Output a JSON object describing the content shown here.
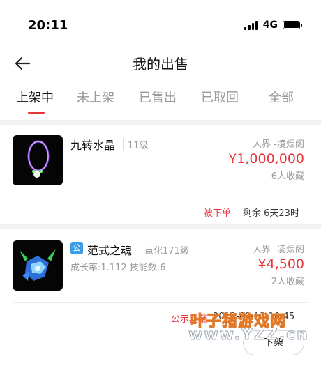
{
  "status_bar": {
    "time": "20:11",
    "network": "4G"
  },
  "header": {
    "title": "我的出售",
    "back_icon": "arrow-left-icon"
  },
  "tabs": [
    {
      "label": "上架中",
      "active": true
    },
    {
      "label": "未上架",
      "active": false
    },
    {
      "label": "已售出",
      "active": false
    },
    {
      "label": "已取回",
      "active": false
    },
    {
      "label": "全部",
      "active": false
    }
  ],
  "accent_color": "#e8333c",
  "listings": [
    {
      "name": "九转水晶",
      "level": "11级",
      "server": "人界 -凌烟阁",
      "price": "¥1,000,000",
      "favorites": "6人收藏",
      "status_label": "被下单",
      "remaining": "剩余 6天23时",
      "thumbnail_icon": "crystal-necklace-icon"
    },
    {
      "badge": "公",
      "name": "范式之魂",
      "level": "点化171级",
      "server": "人界 -凌烟阁",
      "price": "¥4,500",
      "favorites": "2人收藏",
      "stats": "成长率:1.112 技能数:6",
      "status_label": "公示期至",
      "time": "2019-09-13 10:45",
      "button": "下架",
      "thumbnail_icon": "spirit-creature-icon"
    }
  ],
  "watermark": {
    "line1": "叶子猪游戏网",
    "line2": "www.YZZ.cn"
  }
}
